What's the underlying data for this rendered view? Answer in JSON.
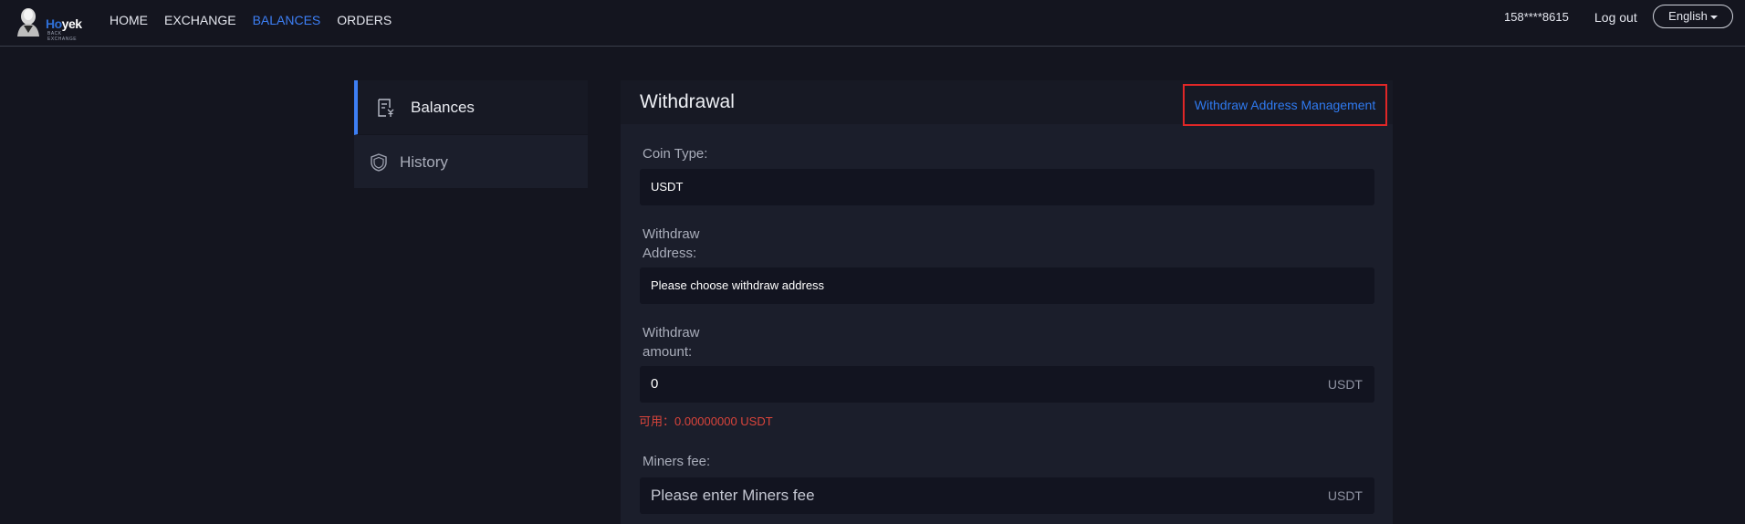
{
  "header": {
    "logo": {
      "brand_hi": "Ho",
      "brand_rest": "yek",
      "sub": "BACK EXCHANGE"
    },
    "nav": [
      {
        "label": "HOME",
        "active": false
      },
      {
        "label": "EXCHANGE",
        "active": false
      },
      {
        "label": "BALANCES",
        "active": true
      },
      {
        "label": "ORDERS",
        "active": false
      }
    ],
    "user_phone": "158****8615",
    "logout_label": "Log out",
    "language": "English"
  },
  "sidebar": {
    "items": [
      {
        "label": "Balances",
        "active": true,
        "icon": "balance-doc-icon"
      },
      {
        "label": "History",
        "active": false,
        "icon": "shield-icon"
      }
    ]
  },
  "withdrawal": {
    "title": "Withdrawal",
    "address_management_label": "Withdraw Address Management",
    "coin_type": {
      "label": "Coin Type:",
      "value": "USDT"
    },
    "address": {
      "label_line1": "Withdraw",
      "label_line2": "Address:",
      "value": "Please choose withdraw address"
    },
    "amount": {
      "label_line1": "Withdraw",
      "label_line2": "amount:",
      "value": "0",
      "unit": "USDT"
    },
    "available": "可用：0.00000000 USDT",
    "miners_fee": {
      "label": "Miners fee:",
      "placeholder": "Please enter Miners fee",
      "unit": "USDT"
    }
  },
  "colors": {
    "accent": "#3d7ff5",
    "background": "#14151f",
    "panel": "#1b1e2b",
    "highlight_border": "#e02727",
    "warning_text": "#d9443b"
  }
}
